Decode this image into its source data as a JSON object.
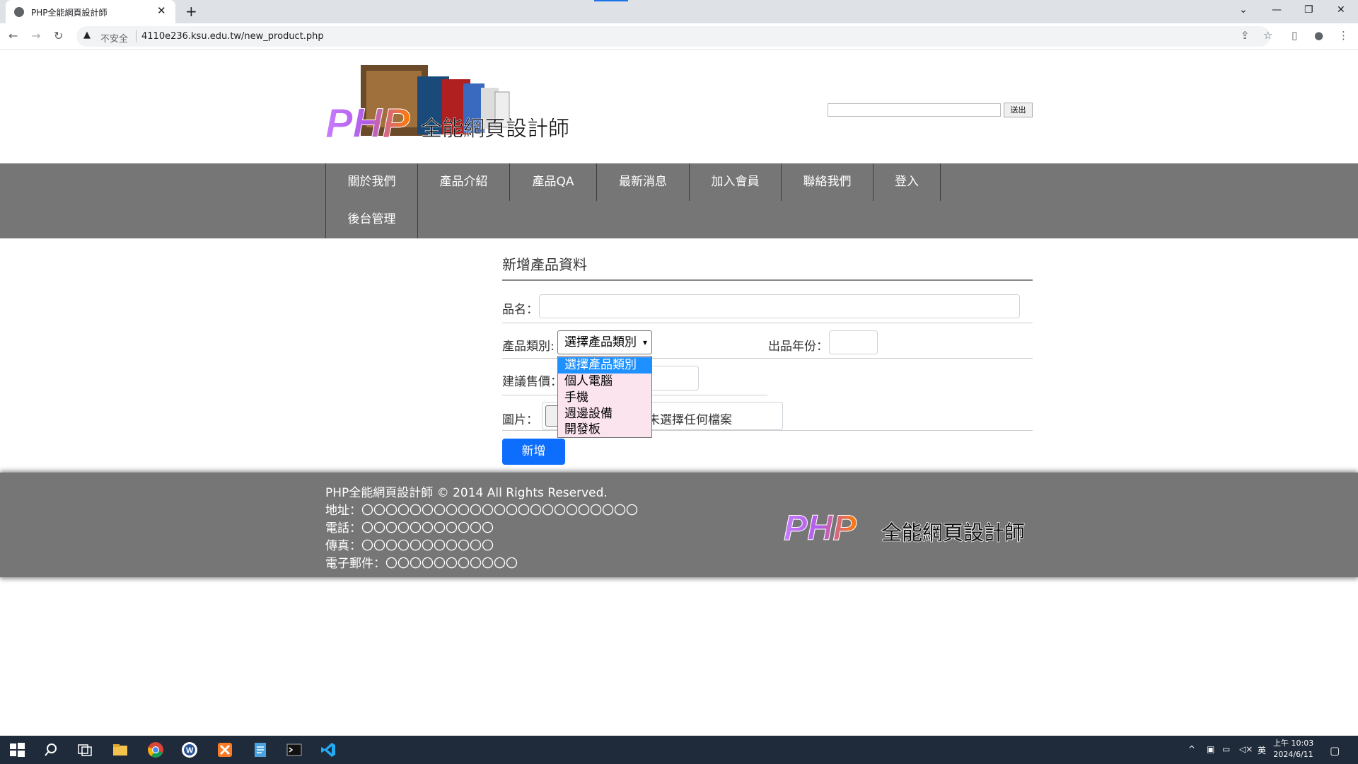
{
  "browser": {
    "tab_title": "PHP全能網頁設計師",
    "security_label": "不安全",
    "url": "4110e236.ksu.edu.tw/new_product.php"
  },
  "header": {
    "logo_text_php": "PHP",
    "logo_text_cn": "全能網頁設計師",
    "search_placeholder": "",
    "search_button": "送出"
  },
  "nav": {
    "items": [
      "關於我們",
      "產品介紹",
      "產品QA",
      "最新消息",
      "加入會員",
      "聯絡我們",
      "登入",
      "後台管理"
    ]
  },
  "form": {
    "title": "新增產品資料",
    "name_label": "品名：",
    "name_value": "",
    "category_label": "產品類別:",
    "category_selected": "選擇產品類別",
    "category_options": [
      "選擇產品類別",
      "個人電腦",
      "手機",
      "週邊設備",
      "開發板"
    ],
    "year_label": "出品年份：",
    "year_value": "",
    "price_label": "建議售價：",
    "price_value": "",
    "image_label": "圖片：",
    "file_status": "未選擇任何檔案",
    "submit_label": "新增"
  },
  "footer": {
    "copyright": "PHP全能網頁設計師 © 2014 All Rights Reserved.",
    "address": "地址：〇〇〇〇〇〇〇〇〇〇〇〇〇〇〇〇〇〇〇〇〇〇〇",
    "phone": "電話：〇〇〇〇〇〇〇〇〇〇〇",
    "fax": "傳真：〇〇〇〇〇〇〇〇〇〇〇",
    "email": "電子郵件：〇〇〇〇〇〇〇〇〇〇〇",
    "logo_text_php": "PHP",
    "logo_text_cn": "全能網頁設計師"
  },
  "taskbar": {
    "time": "上午 10:03",
    "date": "2024/6/11",
    "ime": "英"
  },
  "colors": {
    "nav_bg": "#767676",
    "primary": "#0d6efd",
    "dropdown_bg": "#fce4ef",
    "dropdown_selected": "#1e90ff"
  }
}
